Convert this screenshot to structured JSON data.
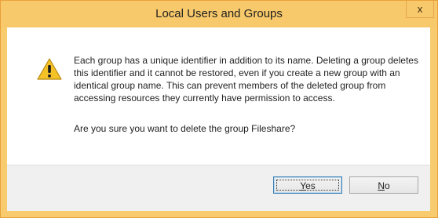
{
  "dialog": {
    "title": "Local Users and Groups",
    "close_glyph": "x",
    "icon": "warning-icon",
    "message": "Each group has a unique identifier in addition to its name. Deleting a group deletes this identifier and it cannot be restored, even if you create a new group with an identical group name. This can prevent members of the deleted group from accessing resources they currently have permission to access.",
    "question": "Are you sure you want to delete the group Fileshare?"
  },
  "buttons": {
    "yes": {
      "mnemonic": "Y",
      "rest": "es"
    },
    "no": {
      "mnemonic": "N",
      "rest": "o"
    }
  },
  "colors": {
    "title_bar": "#f8c96a",
    "border": "#e9a13a",
    "default_button_border": "#3c7fb1"
  }
}
